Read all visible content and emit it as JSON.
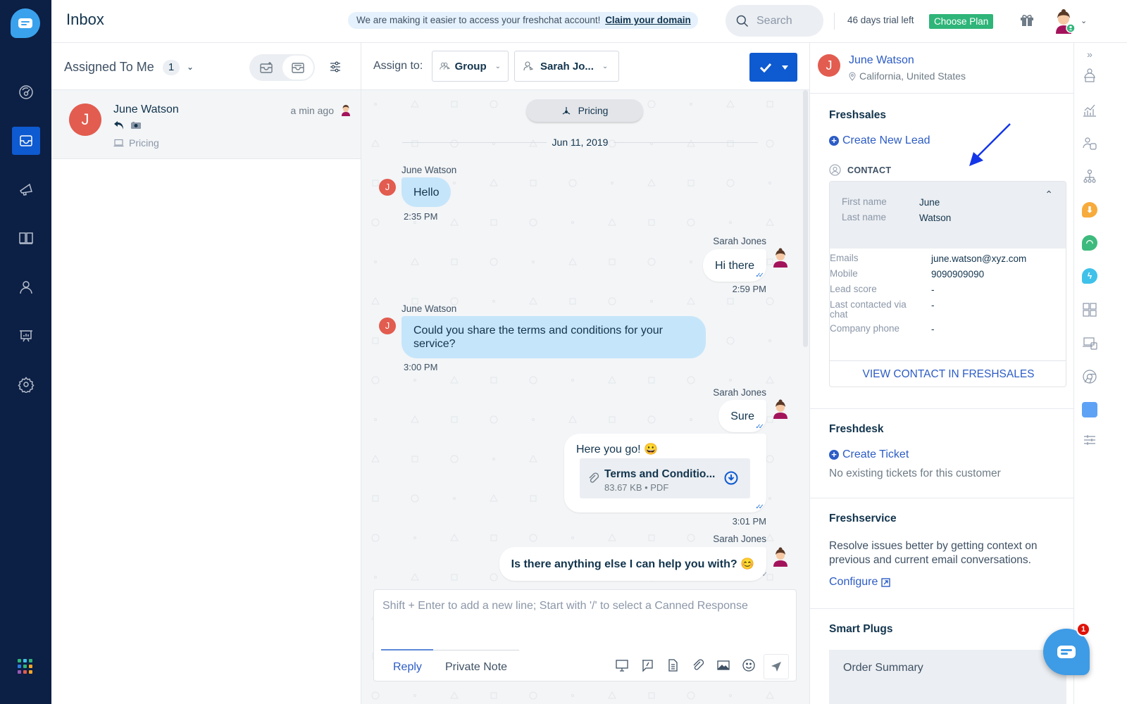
{
  "app": {
    "title": "Inbox"
  },
  "topbar": {
    "banner_text": "We are making it easier to access your freshchat account!",
    "banner_link": "Claim your domain",
    "search_placeholder": "Search",
    "trial_text": "46 days trial left",
    "choose_plan": "Choose Plan"
  },
  "leftnav": {
    "items": [
      {
        "icon": "dashboard-icon",
        "label": "Dashboard"
      },
      {
        "icon": "inbox-icon",
        "label": "Inbox",
        "active": true
      },
      {
        "icon": "megaphone-icon",
        "label": "Campaigns"
      },
      {
        "icon": "book-icon",
        "label": "FAQ"
      },
      {
        "icon": "contacts-icon",
        "label": "Contacts"
      },
      {
        "icon": "reports-icon",
        "label": "Reports"
      },
      {
        "icon": "settings-icon",
        "label": "Settings"
      }
    ],
    "app_grid_colors": [
      "#2fb579",
      "#3fc1ea",
      "#2fb579",
      "#2c7ae0",
      "#2fb579",
      "#f5a623",
      "#9b59b6",
      "#e25c4f",
      "#f5a623"
    ]
  },
  "list": {
    "filter_label": "Assigned To Me",
    "count": "1",
    "conversations": [
      {
        "initial": "J",
        "name": "June Watson",
        "time": "a min ago",
        "topic": "Pricing"
      }
    ]
  },
  "chat_header": {
    "assign_label": "Assign to:",
    "group": "Group",
    "agent": "Sarah Jo..."
  },
  "chat": {
    "topic": "Pricing",
    "date": "Jun 11, 2019",
    "messages": [
      {
        "from": "June Watson",
        "direction": "in",
        "text": "Hello",
        "time": "2:35 PM"
      },
      {
        "from": "Sarah Jones",
        "direction": "out",
        "text": "Hi there",
        "time": "2:59 PM"
      },
      {
        "from": "June Watson",
        "direction": "in",
        "text": "Could you share the terms and conditions for your service?",
        "time": "3:00 PM"
      },
      {
        "from": "Sarah Jones",
        "direction": "out",
        "text": "Sure",
        "time": ""
      },
      {
        "from": "Sarah Jones",
        "direction": "out",
        "text": "Here you go! 😀",
        "time": "3:01 PM",
        "attachment": {
          "name": "Terms and Conditio...",
          "meta": "83.67 KB • PDF"
        }
      },
      {
        "from": "Sarah Jones",
        "direction": "out",
        "text": "Is there anything else I can help you with? 😊",
        "time": ""
      }
    ]
  },
  "composer": {
    "placeholder": "Shift + Enter to add a new line; Start with '/' to select a Canned Response",
    "tabs": [
      "Reply",
      "Private Note"
    ]
  },
  "contact": {
    "initial": "J",
    "name": "June Watson",
    "location": "California, United States"
  },
  "freshsales": {
    "title": "Freshsales",
    "create_lead": "Create New Lead",
    "contact_label": "CONTACT",
    "fields": [
      {
        "key": "First name",
        "value": "June"
      },
      {
        "key": "Last name",
        "value": "Watson"
      },
      {
        "key": "Emails",
        "value": "june.watson@xyz.com"
      },
      {
        "key": "Mobile",
        "value": "9090909090"
      },
      {
        "key": "Lead score",
        "value": "-"
      },
      {
        "key": "Last contacted via chat",
        "value": "-"
      },
      {
        "key": "Company phone",
        "value": "-"
      }
    ],
    "view_button": "VIEW CONTACT IN FRESHSALES"
  },
  "freshdesk": {
    "title": "Freshdesk",
    "create_ticket": "Create Ticket",
    "empty_text": "No existing tickets for this customer"
  },
  "freshservice": {
    "title": "Freshservice",
    "text": "Resolve issues better by getting context on previous and current email conversations.",
    "configure": "Configure"
  },
  "smartplugs": {
    "title": "Smart Plugs",
    "item": "Order Summary"
  },
  "fab": {
    "badge": "1"
  }
}
